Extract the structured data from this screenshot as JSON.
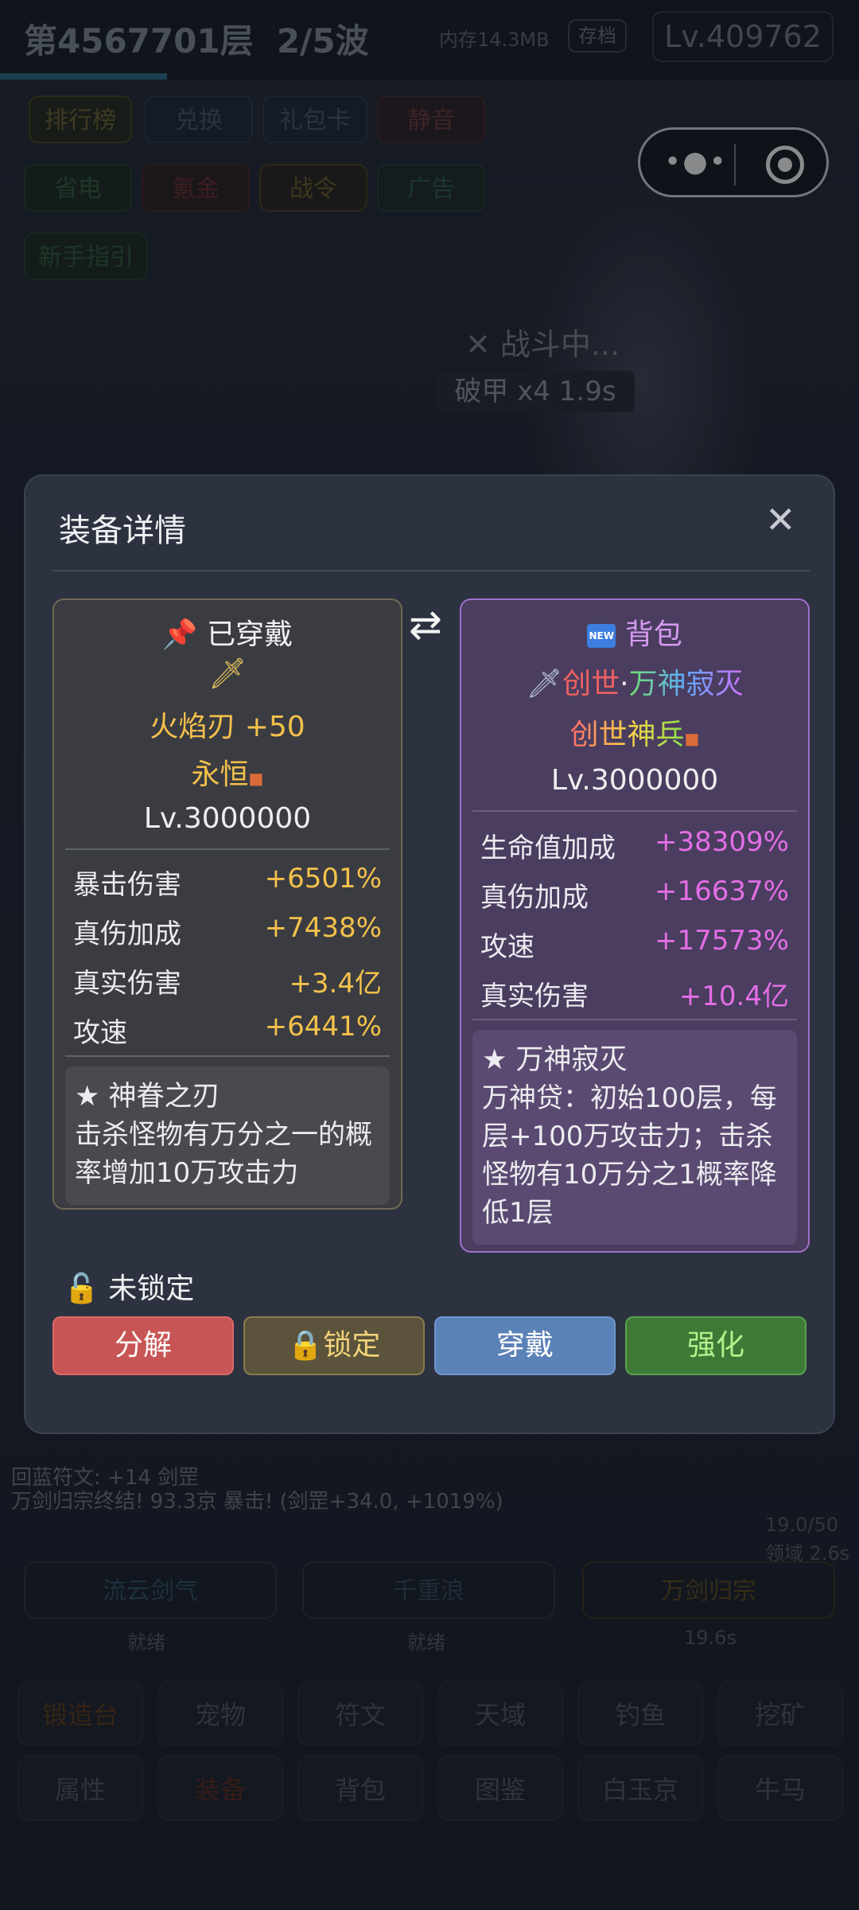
{
  "header": {
    "floor": "第4567701层",
    "wave": "2/5波",
    "memory": "内存14.3MB",
    "save_label": "存档",
    "level": "Lv.409762"
  },
  "top_buttons": [
    {
      "label": "排行榜",
      "color": "#7a6a2c"
    },
    {
      "label": "兑换",
      "color": "#4a5a72"
    },
    {
      "label": "礼包卡",
      "color": "#4a5a72"
    },
    {
      "label": "静音",
      "color": "#6a3a3a"
    },
    {
      "label": "省电",
      "color": "#2e5a3a"
    },
    {
      "label": "氪金",
      "color": "#6a2e2e"
    },
    {
      "label": "战令",
      "color": "#6a5a2a"
    },
    {
      "label": "广告",
      "color": "#2e5a4a"
    },
    {
      "label": "新手指引",
      "color": "#2e5a3a"
    }
  ],
  "battle": {
    "status": "✕ 战斗中...",
    "debuff": "破甲 x4 1.9s"
  },
  "log": [
    "回蓝符文: +14 剑罡",
    "万剑归宗终结! 93.3京 暴击! (剑罡+34.0, +1019%)"
  ],
  "skills": [
    {
      "name": "流云剑气",
      "status": "就绪"
    },
    {
      "name": "千重浪",
      "status": "就绪"
    },
    {
      "name": "万剑归宗",
      "status": "19.6s"
    }
  ],
  "mana": {
    "value": "19.0/50",
    "sub": "领域 2.6s"
  },
  "bottom_tabs_row1": [
    "锻造台",
    "宠物",
    "符文",
    "天域",
    "钓鱼",
    "挖矿"
  ],
  "bottom_tabs_row2": [
    "属性",
    "装备",
    "背包",
    "图鉴",
    "白玉京",
    "牛马"
  ],
  "modal": {
    "title": "装备详情",
    "close_icon": "close-icon",
    "swap_icon": "swap-icon",
    "equipped": {
      "header": "已穿戴",
      "header_icon": "pin-icon",
      "item_icon": "dagger-icon",
      "name": "火焰刃 +50",
      "quality": "永恒",
      "level": "Lv.3000000",
      "stats": [
        {
          "label": "暴击伤害",
          "value": "+6501%"
        },
        {
          "label": "真伤加成",
          "value": "+7438%"
        },
        {
          "label": "真实伤害",
          "value": "+3.4亿"
        },
        {
          "label": "攻速",
          "value": "+6441%"
        }
      ],
      "skill_title": "★ 神眷之刃",
      "skill_desc": "击杀怪物有万分之一的概率增加10万攻击力",
      "accent_color": "#f4c14a"
    },
    "bag": {
      "header": "背包",
      "header_icon": "new-badge-icon",
      "new_badge": "NEW",
      "item_icon": "sword-icon",
      "name_part1": "创世",
      "name_dot": "·",
      "name_part2": "万神寂灭",
      "quality": "创世神兵",
      "level": "Lv.3000000",
      "stats": [
        {
          "label": "生命值加成",
          "value": "+38309%"
        },
        {
          "label": "真伤加成",
          "value": "+16637%"
        },
        {
          "label": "攻速",
          "value": "+17573%"
        },
        {
          "label": "真实伤害",
          "value": "+10.4亿"
        }
      ],
      "skill_title": "★ 万神寂灭",
      "skill_desc": "万神贷：初始100层，每层+100万攻击力；击杀怪物有10万分之1概率降低1层",
      "accent_color": "#e46ee6"
    },
    "lock_status": "未锁定",
    "buttons": {
      "decompose": "分解",
      "lock": "锁定",
      "equip": "穿戴",
      "upgrade": "强化"
    }
  }
}
